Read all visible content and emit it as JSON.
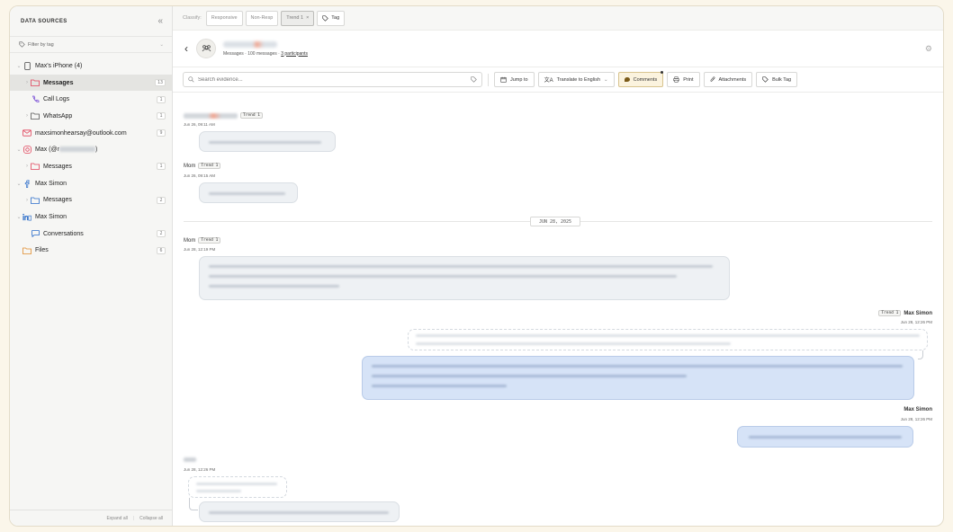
{
  "sidebar": {
    "title": "DATA SOURCES",
    "filter_label": "Filter by tag",
    "items": [
      {
        "label": "Max's iPhone (4)"
      },
      {
        "label": "Messages",
        "count": "13"
      },
      {
        "label": "Call Logs",
        "count": "1"
      },
      {
        "label": "WhatsApp",
        "count": "1"
      },
      {
        "label": "maxsimonhearsay@outlook.com",
        "count": "9"
      },
      {
        "label": "Max (@r",
        "label_end": ")"
      },
      {
        "label": "Messages",
        "count": "1"
      },
      {
        "label": "Max Simon"
      },
      {
        "label": "Messages",
        "count": "2"
      },
      {
        "label": "Max Simon"
      },
      {
        "label": "Conversations",
        "count": "2"
      },
      {
        "label": "Files",
        "count": "6"
      }
    ],
    "expand_all": "Expand all",
    "collapse_all": "Collapse all"
  },
  "classify": {
    "label": "Classify:",
    "chips": [
      "Responsive",
      "Non-Resp",
      "Trend 1",
      "Tag"
    ],
    "active_remove": "×"
  },
  "conversation": {
    "subtitle_prefix": "Messages · 100 messages · ",
    "participants_link": "3 participants"
  },
  "toolbar": {
    "search_placeholder": "Search evidence...",
    "jump_to": "Jump to",
    "translate": "Translate to English",
    "comments": "Comments",
    "print": "Print",
    "attachments": "Attachments",
    "bulk_tag": "Bulk Tag"
  },
  "messages": {
    "m1": {
      "tag": "Trend 1",
      "time": "Jun 26, 09:11 AM"
    },
    "m2": {
      "sender": "Mom",
      "tag": "Trend 1",
      "time": "Jun 26, 09:15 AM"
    },
    "date_divider": "JUN 28, 2025",
    "m3": {
      "sender": "Mom",
      "tag": "Trend 1",
      "time": "Jun 28, 12:19 PM"
    },
    "m4": {
      "sender": "Max Simon",
      "tag": "Trend 1",
      "time": "Jun 28, 12:26 PM"
    },
    "m5": {
      "sender": "Max Simon",
      "time": "Jun 28, 12:26 PM"
    },
    "m6": {
      "time": "Jun 28, 12:26 PM"
    }
  },
  "colors": {
    "accent_red": "#e0425a",
    "accent_green": "#2f8a5a",
    "accent_purple": "#7a4fd6",
    "accent_blue": "#2a6cc9",
    "outgoing_bubble": "#d6e3f7",
    "comments_bg": "#fbf3de"
  }
}
